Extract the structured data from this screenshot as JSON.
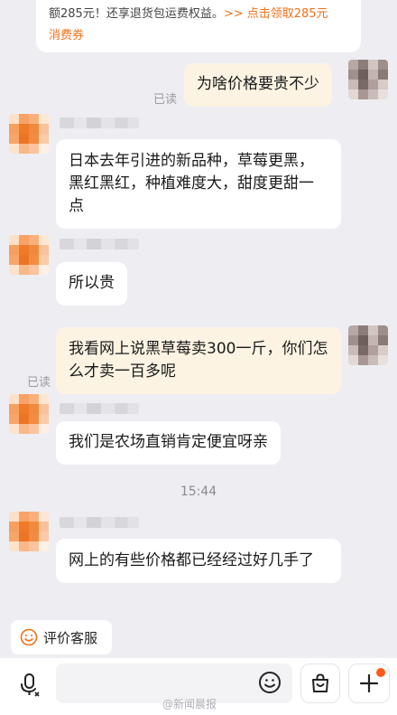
{
  "promo": {
    "text_part1": "额285元！还享退货包运费权益。",
    "link_text": ">> 点击领取285元",
    "text_part2": "消费券"
  },
  "read_label": "已读",
  "messages": [
    {
      "direction": "out",
      "text": "为啥价格要贵不少"
    },
    {
      "direction": "in",
      "text": "日本去年引进的新品种，草莓更黑，黑红黑红，种植难度大，甜度更甜一点"
    },
    {
      "direction": "in",
      "text": "所以贵"
    },
    {
      "direction": "out",
      "text": "我看网上说黑草莓卖300一斤，你们怎么才卖一百多呢"
    },
    {
      "direction": "in",
      "text": "我们是农场直销肯定便宜呀亲"
    },
    {
      "direction": "in",
      "text": "网上的有些价格都已经经过好几手了"
    }
  ],
  "timestamp": "15:44",
  "rate_button": {
    "label": "评价客服",
    "icon": "smile-face-icon"
  },
  "input_bar": {
    "icons": [
      "mic-icon",
      "emoji-icon",
      "shopping-bag-icon",
      "plus-icon"
    ],
    "accent_color": "#ff5a1a"
  },
  "watermark": "@新闻晨报"
}
